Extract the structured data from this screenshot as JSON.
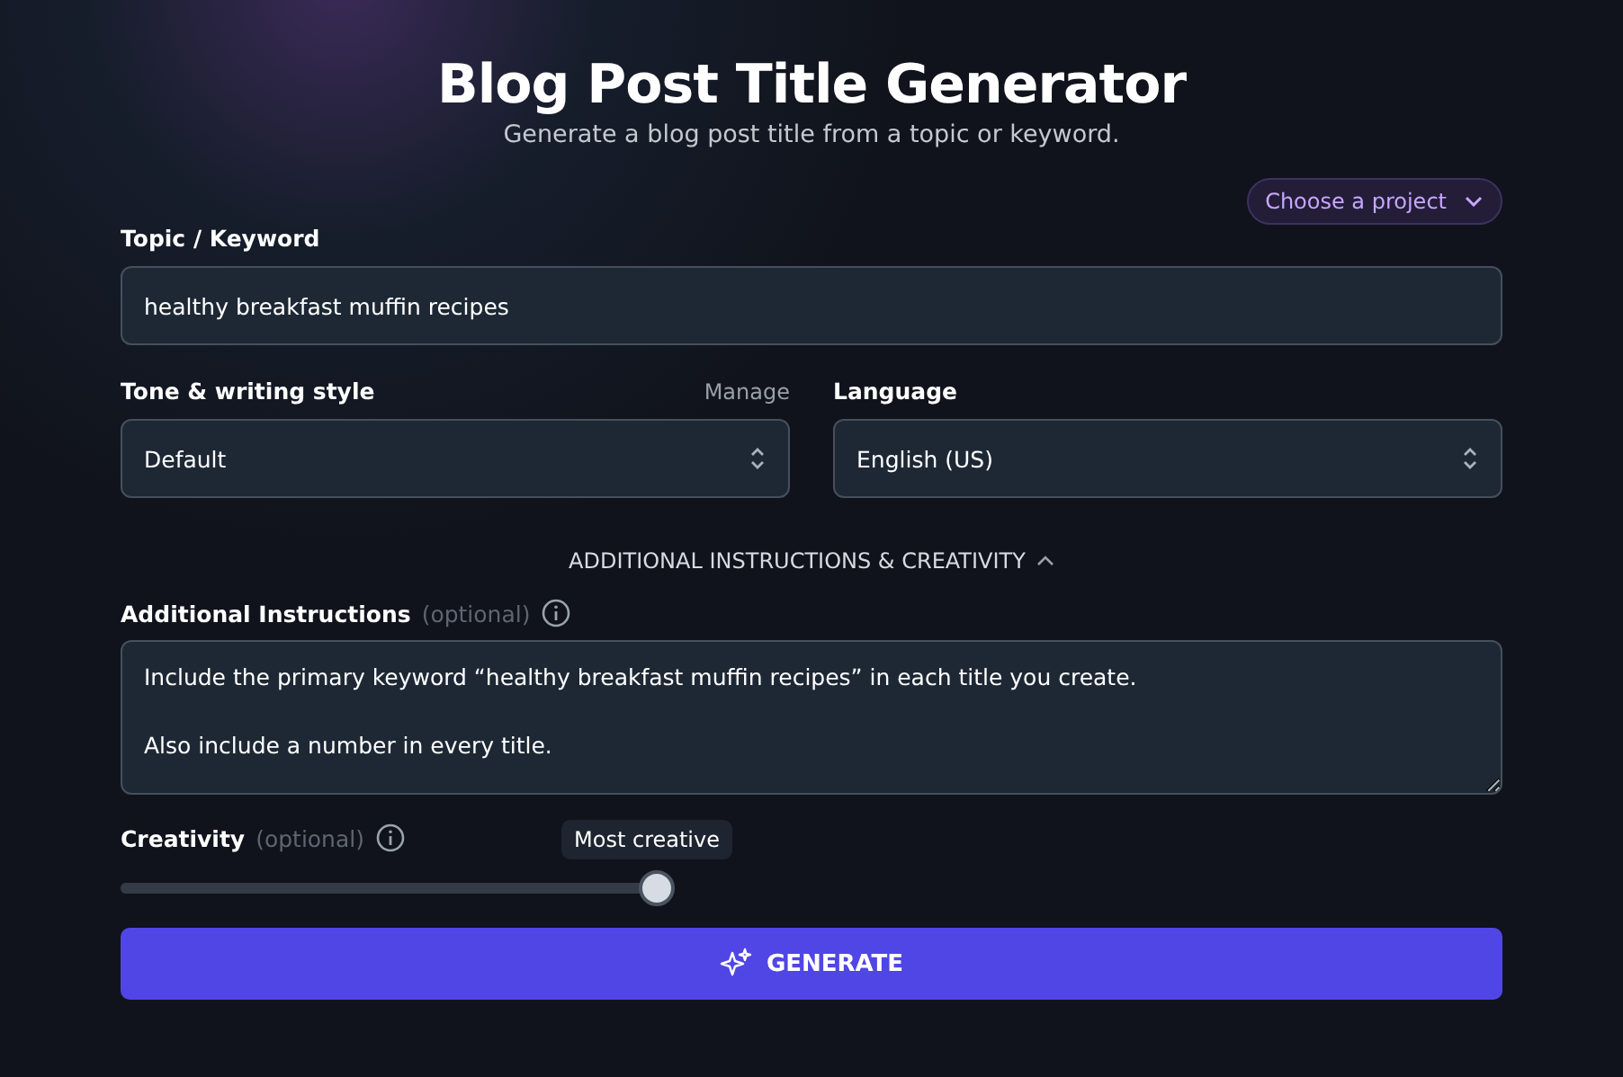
{
  "header": {
    "title": "Blog Post Title Generator",
    "subtitle": "Generate a blog post title from a topic or keyword."
  },
  "project_picker": {
    "label": "Choose a project"
  },
  "topic": {
    "label": "Topic / Keyword",
    "value": "healthy breakfast muffin recipes"
  },
  "tone": {
    "label": "Tone & writing style",
    "manage": "Manage",
    "value": "Default"
  },
  "language": {
    "label": "Language",
    "value": "English (US)"
  },
  "advanced_toggle": {
    "label": "ADDITIONAL INSTRUCTIONS & CREATIVITY",
    "expanded": true
  },
  "instructions": {
    "label": "Additional Instructions",
    "optional": "(optional)",
    "value": "Include the primary keyword “healthy breakfast muffin recipes” in each title you create.\n\nAlso include a number in every title."
  },
  "creativity": {
    "label": "Creativity",
    "optional": "(optional)",
    "tooltip": "Most creative",
    "level": 1
  },
  "generate_button": {
    "label": "GENERATE"
  }
}
